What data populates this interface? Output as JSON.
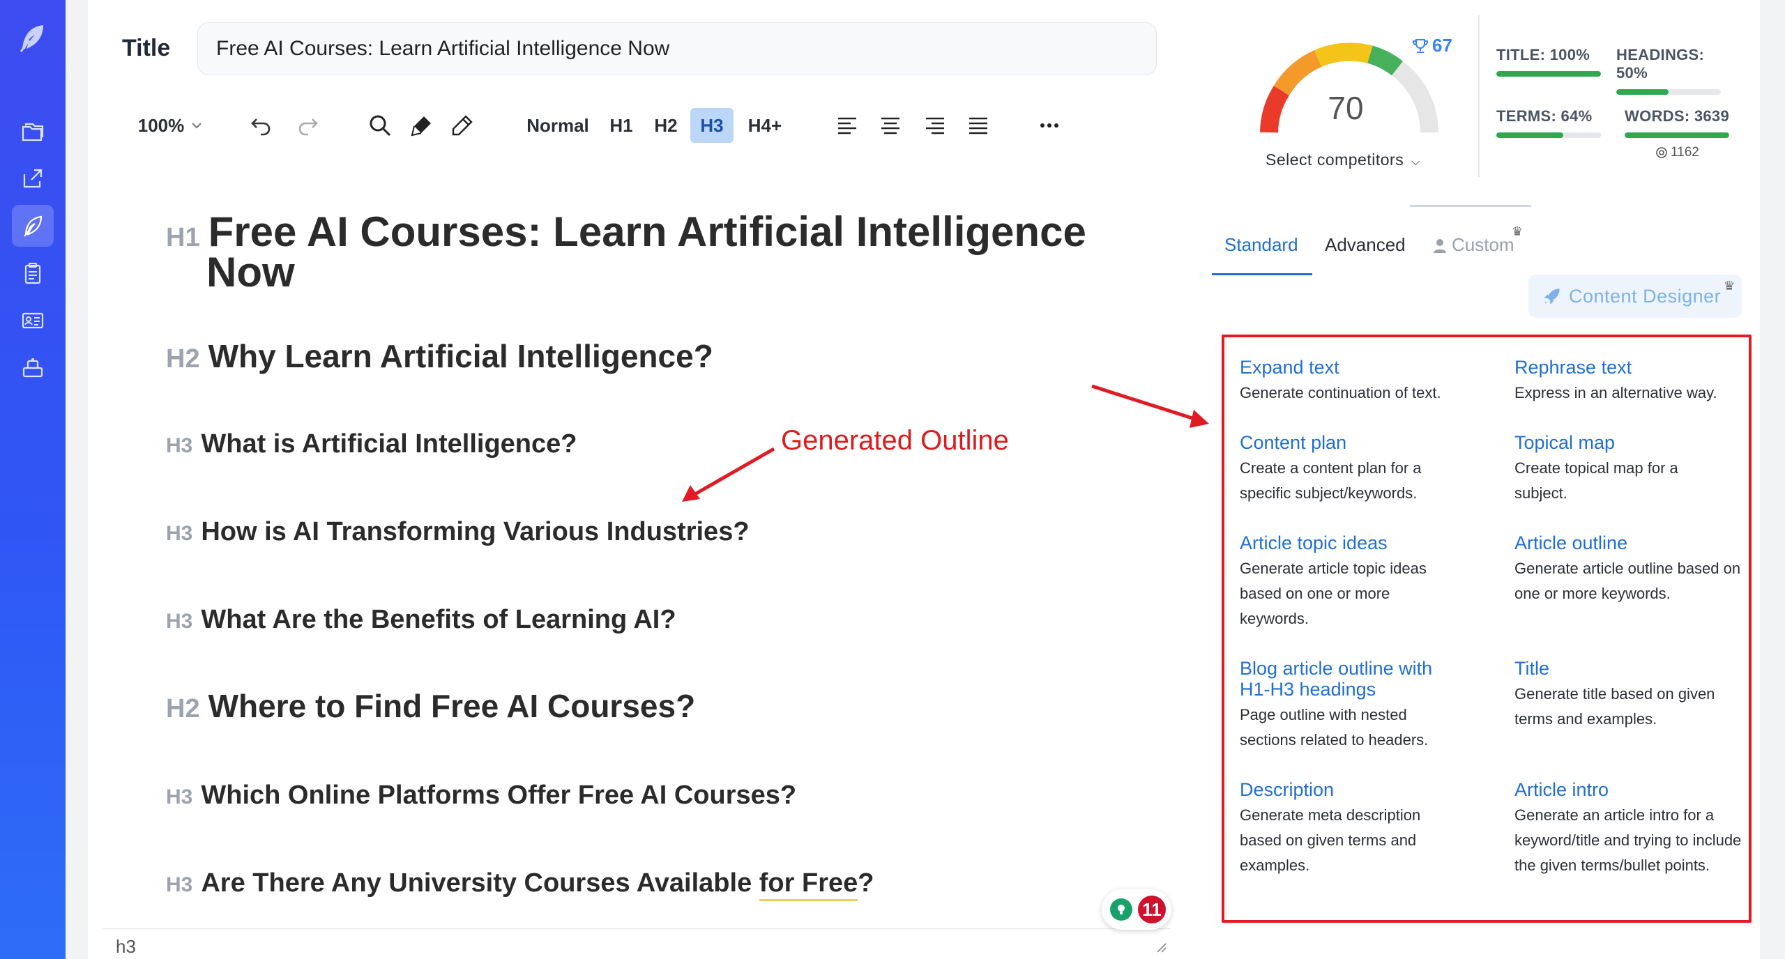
{
  "rail": {
    "items": [
      "folder-icon",
      "share-icon",
      "feather-icon",
      "clipboard-icon",
      "id-card-icon",
      "stack-icon"
    ],
    "active": "feather-icon"
  },
  "editor_header": {
    "title_label": "Title",
    "title_value": "Free AI Courses: Learn Artificial Intelligence Now"
  },
  "toolbar": {
    "zoom": "100%",
    "headings": [
      "Normal",
      "H1",
      "H2",
      "H3",
      "H4+"
    ],
    "selected_heading": "H3"
  },
  "document": {
    "blocks": [
      {
        "tag": "H1",
        "text_line1": "Free AI Courses: Learn Artificial Intelligence",
        "text_line2": "Now"
      },
      {
        "tag": "H2",
        "text": "Why Learn Artificial Intelligence?"
      },
      {
        "tag": "H3",
        "text": "What is Artificial Intelligence?"
      },
      {
        "tag": "H3",
        "text": "How is AI Transforming Various Industries?"
      },
      {
        "tag": "H3",
        "text": "What Are the Benefits of Learning AI?"
      },
      {
        "tag": "H2",
        "text": "Where to Find Free AI Courses?"
      },
      {
        "tag": "H3",
        "text": "Which Online Platforms Offer Free AI Courses?"
      },
      {
        "tag": "H3",
        "text_before": "Are There Any University Courses Available ",
        "text_underlined": "for Free",
        "text_after": "?"
      }
    ],
    "annotation": "Generated Outline",
    "status": "h3",
    "issues_count": "11"
  },
  "score_panel": {
    "score": "70",
    "competitor_score": "67",
    "select_competitors": "Select competitors",
    "metrics": [
      {
        "label": "TITLE: 100%",
        "value": 1.0
      },
      {
        "label": "HEADINGS: 50%",
        "value": 0.5
      },
      {
        "label": "TERMS: 64%",
        "value": 0.64
      },
      {
        "label": "WORDS: 3639",
        "value": 1.0
      }
    ],
    "words_sub": "1162"
  },
  "tabs": {
    "standard": "Standard",
    "advanced": "Advanced",
    "custom": "Custom",
    "active": "Standard"
  },
  "content_designer": "Content Designer",
  "tools": [
    {
      "name": "Expand text",
      "desc": "Generate continuation of text."
    },
    {
      "name": "Rephrase text",
      "desc": "Express in an alternative way."
    },
    {
      "name": "Content plan",
      "desc": "Create a content plan for a specific subject/keywords."
    },
    {
      "name": "Topical map",
      "desc": "Create topical map for a subject."
    },
    {
      "name": "Article topic ideas",
      "desc": "Generate article topic ideas based on one or more keywords."
    },
    {
      "name": "Article outline",
      "desc": "Generate article outline based on one or more keywords."
    },
    {
      "name": "Blog article outline with H1-H3 headings",
      "desc": "Page outline with nested sections related to headers."
    },
    {
      "name": "Title",
      "desc": "Generate title based on given terms and examples."
    },
    {
      "name": "Description",
      "desc": "Generate meta description based on given terms and examples."
    },
    {
      "name": "Article intro",
      "desc": "Generate an article intro for a keyword/title and trying to include the given terms/bullet points."
    }
  ],
  "colors": {
    "rail": "#3d4cf0",
    "accent": "#1f6fd1",
    "annotation_red": "#e01b24",
    "progress_green": "#2fa84f"
  }
}
